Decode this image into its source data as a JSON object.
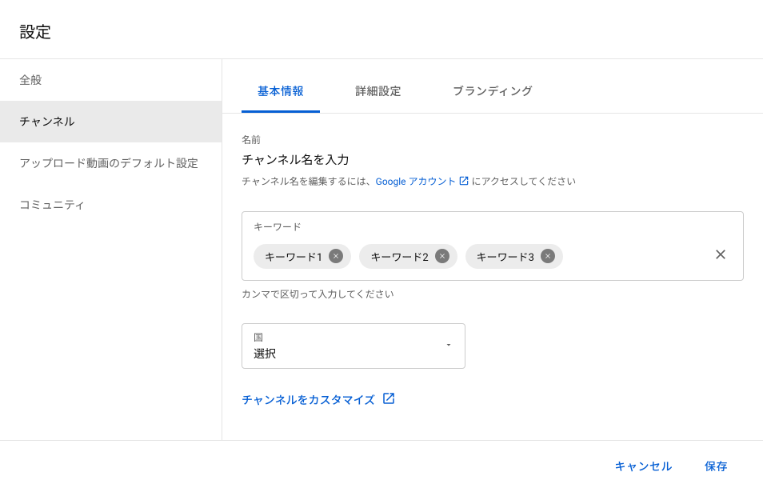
{
  "header": {
    "title": "設定"
  },
  "sidebar": {
    "items": [
      {
        "label": "全般"
      },
      {
        "label": "チャンネル"
      },
      {
        "label": "アップロード動画のデフォルト設定"
      },
      {
        "label": "コミュニティ"
      }
    ],
    "activeIndex": 1
  },
  "tabs": {
    "items": [
      {
        "label": "基本情報"
      },
      {
        "label": "詳細設定"
      },
      {
        "label": "ブランディング"
      }
    ],
    "activeIndex": 0
  },
  "nameSection": {
    "label": "名前",
    "value": "チャンネル名を入力",
    "help_prefix": "チャンネル名を編集するには、",
    "help_link": "Google アカウント",
    "help_suffix": " にアクセスしてください"
  },
  "keywordSection": {
    "label": "キーワード",
    "chips": [
      "キーワード1",
      "キーワード2",
      "キーワード3"
    ],
    "helper": "カンマで区切って入力してください"
  },
  "countrySection": {
    "label": "国",
    "value": "選択"
  },
  "customizeLink": "チャンネルをカスタマイズ",
  "footer": {
    "cancel": "キャンセル",
    "save": "保存"
  }
}
